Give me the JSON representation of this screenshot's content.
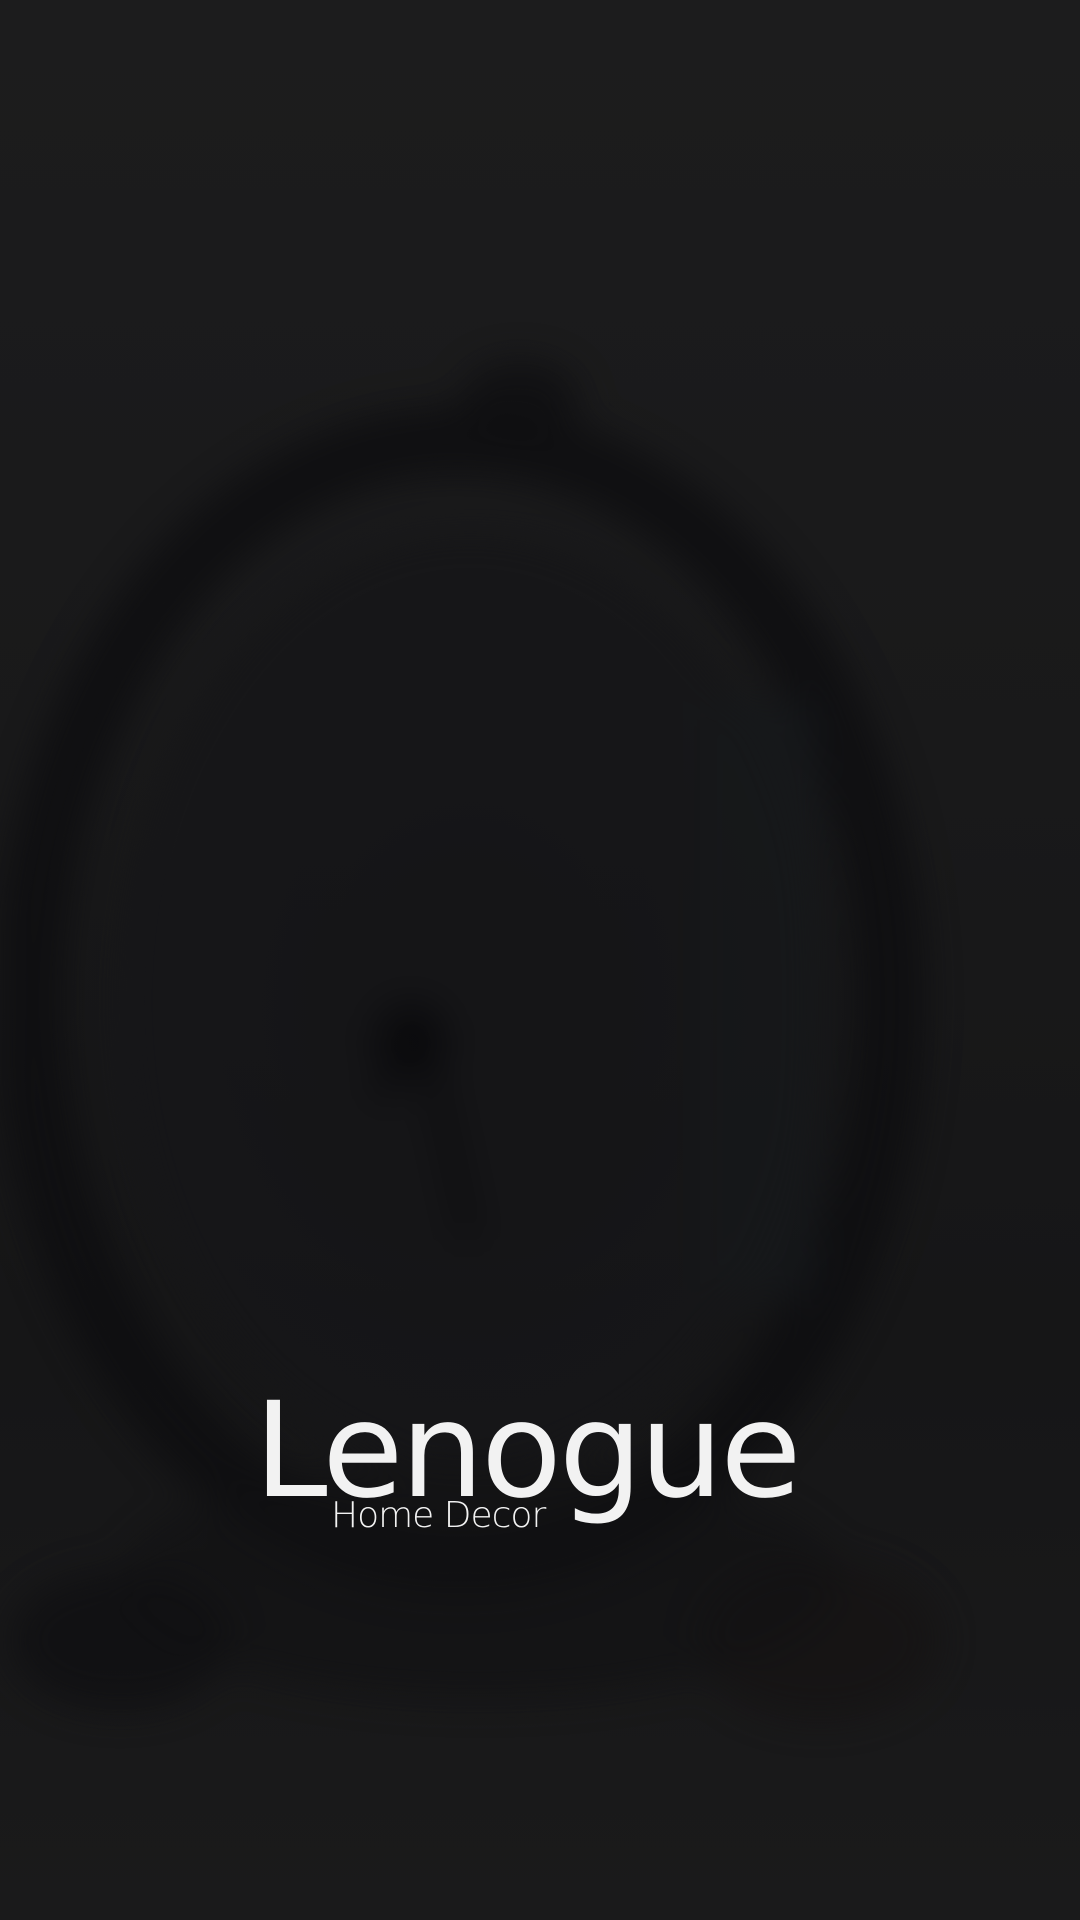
{
  "splash": {
    "brand_name": "Lenogue",
    "tagline": "Home Decor",
    "background_color": "#1b1b1c",
    "text_color": "#f2f2f2",
    "backdrop_subject": "blurred-wall-clock"
  }
}
